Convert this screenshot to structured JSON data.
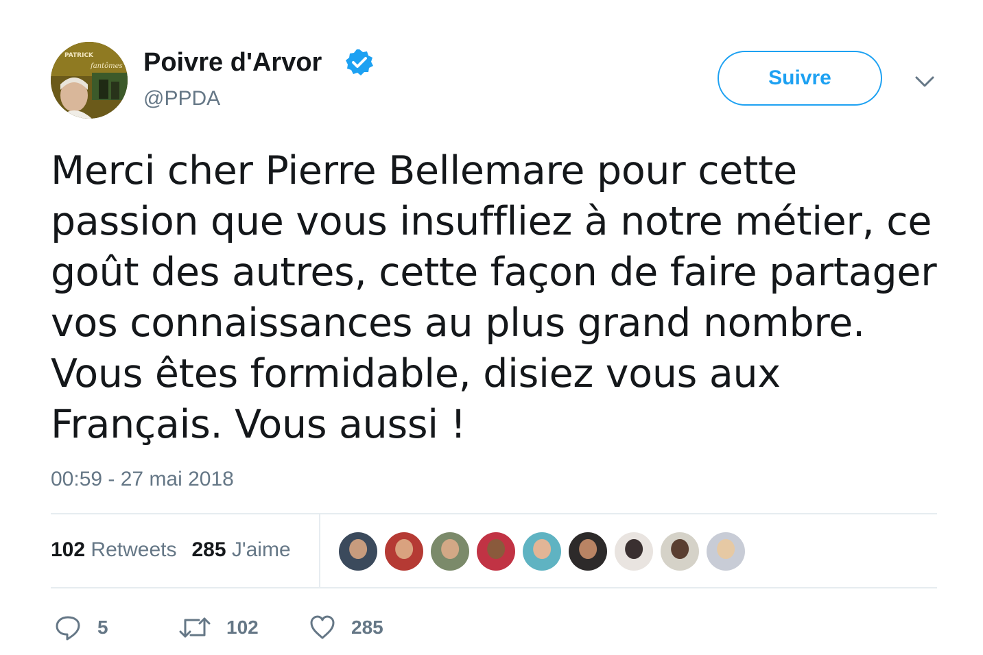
{
  "tweet": {
    "author": {
      "name": "Poivre d'Arvor",
      "handle": "@PPDA",
      "verified": true,
      "avatar_icon": "profile-photo"
    },
    "follow_label": "Suivre",
    "menu_icon": "chevron-down-icon",
    "text": "Merci cher Pierre Bellemare pour cette\npassion que vous insuffliez à notre métier, ce\ngoût des autres, cette façon de faire partager\nvos connaissances au plus grand nombre.\nVous êtes formidable, disiez vous aux\nFrançais. Vous aussi !",
    "timestamp": "00:59 - 27 mai 2018",
    "stats": {
      "retweets_count": "102",
      "retweets_label": "Retweets",
      "likes_count": "285",
      "likes_label": "J'aime"
    },
    "likers": [
      {
        "name": "liker-1",
        "bg": "#3b4a5c",
        "face": "#c79c7e"
      },
      {
        "name": "liker-2",
        "bg": "#b53a34",
        "face": "#d9a27f"
      },
      {
        "name": "liker-3",
        "bg": "#7b8a6a",
        "face": "#d3a886"
      },
      {
        "name": "liker-4",
        "bg": "#c13344",
        "face": "#8a5a3c"
      },
      {
        "name": "liker-5",
        "bg": "#5fb3c2",
        "face": "#e2b596"
      },
      {
        "name": "liker-6",
        "bg": "#2d2a2a",
        "face": "#b98464"
      },
      {
        "name": "liker-7",
        "bg": "#e9e4e0",
        "face": "#3a3030"
      },
      {
        "name": "liker-8",
        "bg": "#d5d2c8",
        "face": "#5a3f31"
      },
      {
        "name": "liker-9",
        "bg": "#c8ccd6",
        "face": "#e6c9a4"
      }
    ],
    "actions": {
      "reply_count": "5",
      "retweet_count": "102",
      "like_count": "285"
    }
  },
  "colors": {
    "accent": "#1da1f2",
    "secondary_text": "#657786",
    "text": "#14171a",
    "divider": "#e6ecf0"
  }
}
